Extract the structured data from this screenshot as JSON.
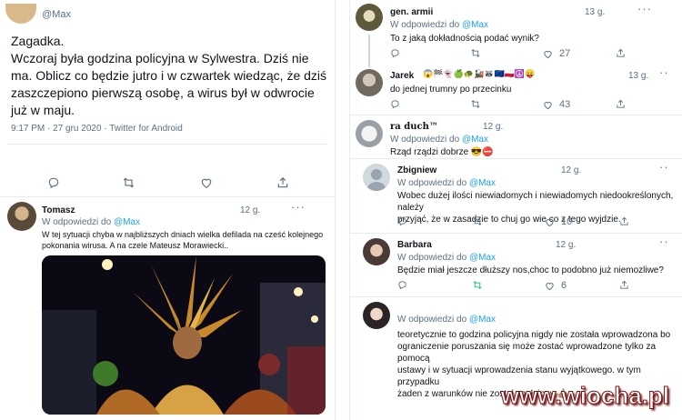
{
  "main_tweet": {
    "handle": "@Max",
    "text_lines": [
      "Zagadka.",
      "Wczoraj była godzina policyjna w Sylwestra. Dziś nie",
      "ma. Oblicz co będzie jutro i w czwartek wiedząc, że dziś",
      "zaszczepiono pierwszą osobę, a wirus był w odwrocie",
      "już w maju."
    ],
    "meta": "9:17 PM · 27 gru 2020 · Twitter for Android"
  },
  "left_reply": {
    "name": "Tomasz",
    "time": "12 g.",
    "reply_to_prefix": "W odpowiedzi do",
    "reply_to": "@Max",
    "text_lines": [
      "W tej sytuacji chyba w najbliższych dniach wielka defilada na cześć kolejnego",
      "pokonania wirusa. A na czele Mateusz Morawiecki.."
    ],
    "image_alt": "carnival-parade-photo"
  },
  "replies": [
    {
      "name": "gen. armii",
      "time": "13 g.",
      "reply_to_prefix": "W odpowiedzi do",
      "reply_to": "@Max",
      "text_lines": [
        "To z jaką dokładnością podać wynik?"
      ],
      "likes": "27"
    },
    {
      "name": "Jarek",
      "emoji": "😱🏁👻🍏🐢🚂🦝🇪🇺🇵🇱☮️😛",
      "time": "13 g.",
      "text_lines": [
        "do jednej trumny po przecinku"
      ],
      "likes": "43"
    },
    {
      "name": "ra duch™",
      "time": "12 g.",
      "reply_to_prefix": "W odpowiedzi do",
      "reply_to": "@Max",
      "text_lines": [
        "Rząd rządzi dobrze 😎⛔"
      ]
    },
    {
      "name": "Zbigniew",
      "time": "12 g.",
      "reply_to_prefix": "W odpowiedzi do",
      "reply_to": "@Max",
      "text_lines": [
        "Wobec dużej ilości niewiadomych i niewiadomych niedookreślonych, należy",
        "przyjąć, że w zasadzie to chuj go wie co z tego wyjdzie."
      ],
      "likes": "10"
    },
    {
      "name": "Barbara",
      "time": "12 g.",
      "reply_to_prefix": "W odpowiedzi do",
      "reply_to": "@Max",
      "text_lines": [
        "Będzie miał jeszcze dłuższy nos,choc to podobno już niemozliwe?"
      ],
      "likes": "6"
    },
    {
      "name": "",
      "reply_to_prefix": "W odpowiedzi do",
      "reply_to": "@Max",
      "text_lines": [
        "teoretycznie to godzina policyjna nigdy nie została wprowadzona bo",
        "ograniczenie poruszania się może zostać wprowadzone tylko za pomocą",
        "ustawy i w sytuacji wprowadzenia stanu wyjątkowego. w tym przypadku",
        "żaden z warunków nie został spełniony 👍🏽"
      ]
    }
  ],
  "watermark": "www.wiocha.pl",
  "colors": {
    "accent": "#1da1f2",
    "retweet_green": "#17bf63",
    "muted": "#5b7083",
    "border": "#e6ecf0"
  }
}
